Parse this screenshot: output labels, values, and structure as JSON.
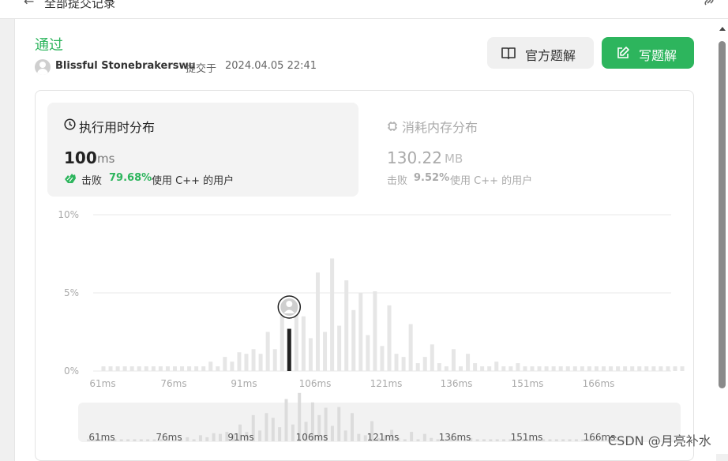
{
  "topbar": {
    "title": "全部提交记录"
  },
  "submission": {
    "status": "通过",
    "username": "Blissful Stonebrakerswu",
    "submitted_label": "提交于",
    "submitted_time": "2024.04.05 22:41"
  },
  "buttons": {
    "official_solution": "官方题解",
    "write_solution": "写题解"
  },
  "runtime": {
    "title": "执行用时分布",
    "value": "100",
    "unit": "ms",
    "beats_label": "击败",
    "beats_pct": "79.68%",
    "beats_suffix": "使用 C++ 的用户"
  },
  "memory": {
    "title": "消耗内存分布",
    "value": "130.22",
    "unit": "MB",
    "beats_label": "击败",
    "beats_pct": "9.52%",
    "beats_suffix": "使用 C++ 的用户"
  },
  "colors": {
    "accent": "#2db55d",
    "bar": "#e6e6e6",
    "highlight_bar": "#222222"
  },
  "chart_data": {
    "type": "bar",
    "y_tick_labels": [
      "10%",
      "5%",
      "0%"
    ],
    "ylim": [
      0,
      10
    ],
    "x_tick_labels": [
      "61ms",
      "76ms",
      "91ms",
      "106ms",
      "121ms",
      "136ms",
      "151ms",
      "166ms"
    ],
    "x_start_ms": 61,
    "x_step_ms": 1.5,
    "values": [
      0.3,
      0.3,
      0.3,
      0.3,
      0.3,
      0.3,
      0.3,
      0.3,
      0.3,
      0.3,
      0.3,
      0.3,
      0.3,
      0.3,
      0.3,
      0.6,
      0.3,
      0.9,
      0.6,
      1.2,
      1.1,
      1.4,
      1.1,
      2.5,
      1.4,
      3.9,
      1.6,
      4.2,
      3.5,
      2.1,
      6.3,
      2.5,
      7.2,
      2.9,
      5.8,
      3.9,
      5.0,
      2.3,
      5.1,
      1.6,
      4.2,
      1.1,
      0.9,
      3.0,
      0.5,
      0.9,
      1.7,
      0.5,
      0.3,
      1.4,
      0.3,
      1.1,
      0.5,
      0.3,
      0.3,
      0.6,
      0.3,
      0.3,
      0.5,
      0.3,
      0.3,
      0.3,
      0.3,
      0.3,
      0.3,
      0.3,
      0.3,
      0.3,
      0.3,
      0.3,
      0.3,
      0.3,
      0.3,
      0.3,
      0.3,
      0.3,
      0.3,
      0.3,
      0.3,
      0.3,
      0.3,
      0.3
    ],
    "highlight_index": 26,
    "highlight_value": 2.7,
    "grid": true
  }
}
